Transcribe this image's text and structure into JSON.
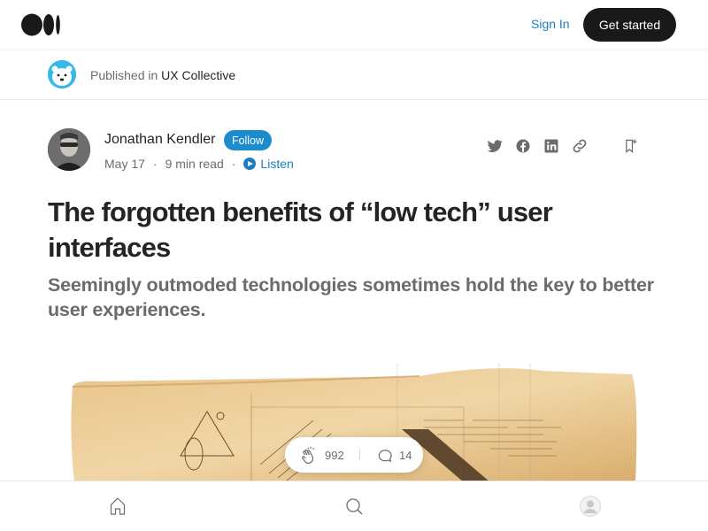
{
  "topbar": {
    "logo_icon": "medium-logo-icon",
    "signin_label": "Sign In",
    "getstarted_label": "Get started"
  },
  "publication": {
    "prefix": "Published in",
    "name": "UX Collective",
    "avatar_icon": "polar-bear-avatar-icon"
  },
  "author": {
    "name": "Jonathan Kendler",
    "follow_label": "Follow",
    "date": "May 17",
    "read_time": "9 min read",
    "listen_label": "Listen"
  },
  "share": {
    "icons": [
      "twitter-icon",
      "facebook-icon",
      "linkedin-icon",
      "link-icon",
      "bookmark-icon"
    ]
  },
  "article": {
    "title": "The forgotten benefits of “low tech” user interfaces",
    "subtitle": "Seemingly outmoded technologies sometimes hold the key to better user experiences."
  },
  "engagement": {
    "claps": "992",
    "responses": "14"
  },
  "bottomnav": {
    "icons": [
      "home-icon",
      "search-icon",
      "profile-icon"
    ]
  },
  "colors": {
    "accent": "#1a7fc0",
    "dark_button": "#191919",
    "text_primary": "#242424",
    "text_secondary": "#6b6b6b"
  }
}
